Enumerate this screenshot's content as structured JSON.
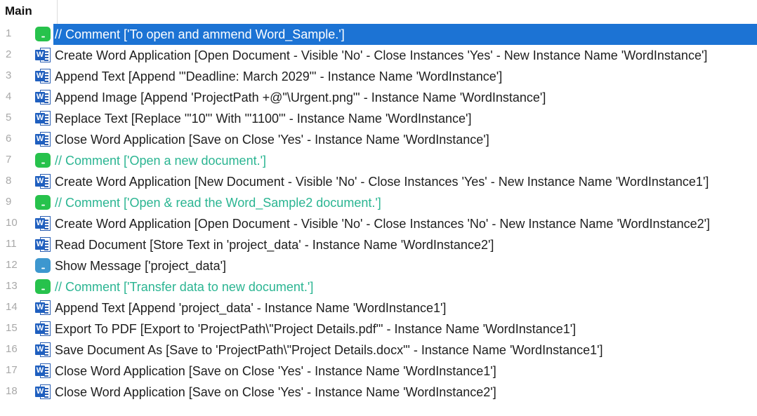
{
  "tab": {
    "label": "Main"
  },
  "lines": [
    {
      "num": "1",
      "kind": "comment",
      "icon": "comment-icon",
      "text": "// Comment ['To open and ammend Word_Sample.']",
      "selected": true
    },
    {
      "num": "2",
      "kind": "word",
      "icon": "word-icon",
      "text": "Create Word Application [Open Document - Visible 'No' - Close Instances 'Yes' - New Instance Name 'WordInstance']"
    },
    {
      "num": "3",
      "kind": "word",
      "icon": "word-icon",
      "text": "Append Text [Append '\"Deadline: March 2029\"' - Instance Name 'WordInstance']"
    },
    {
      "num": "4",
      "kind": "word",
      "icon": "word-icon",
      "text": "Append Image [Append 'ProjectPath +@\"\\Urgent.png\"' - Instance Name 'WordInstance']"
    },
    {
      "num": "5",
      "kind": "word",
      "icon": "word-icon",
      "text": "Replace Text [Replace '\"10\"' With '\"1100\"' - Instance Name 'WordInstance']"
    },
    {
      "num": "6",
      "kind": "word",
      "icon": "word-icon",
      "text": "Close Word Application [Save on Close 'Yes' - Instance Name 'WordInstance']"
    },
    {
      "num": "7",
      "kind": "comment",
      "icon": "comment-icon",
      "text": "// Comment ['Open a new document.']"
    },
    {
      "num": "8",
      "kind": "word",
      "icon": "word-icon",
      "text": "Create Word Application [New Document - Visible 'No' - Close Instances 'Yes' - New Instance Name 'WordInstance1']"
    },
    {
      "num": "9",
      "kind": "comment",
      "icon": "comment-icon",
      "text": "// Comment ['Open & read the Word_Sample2 document.']"
    },
    {
      "num": "10",
      "kind": "word",
      "icon": "word-icon",
      "text": "Create Word Application [Open Document - Visible 'No' - Close Instances 'No' - New Instance Name 'WordInstance2']"
    },
    {
      "num": "11",
      "kind": "word",
      "icon": "word-icon",
      "text": "Read Document [Store Text in 'project_data' - Instance Name 'WordInstance2']"
    },
    {
      "num": "12",
      "kind": "message",
      "icon": "message-icon",
      "text": "Show Message ['project_data']"
    },
    {
      "num": "13",
      "kind": "comment",
      "icon": "comment-icon",
      "text": "// Comment ['Transfer data to new document.']"
    },
    {
      "num": "14",
      "kind": "word",
      "icon": "word-icon",
      "text": "Append Text [Append 'project_data' - Instance Name 'WordInstance1']"
    },
    {
      "num": "15",
      "kind": "word",
      "icon": "word-icon",
      "text": "Export To PDF [Export to 'ProjectPath\\\"Project Details.pdf\"' - Instance Name 'WordInstance1']"
    },
    {
      "num": "16",
      "kind": "word",
      "icon": "word-icon",
      "text": "Save Document As [Save to 'ProjectPath\\\"Project Details.docx\"' - Instance Name 'WordInstance1']"
    },
    {
      "num": "17",
      "kind": "word",
      "icon": "word-icon",
      "text": "Close Word Application [Save on Close 'Yes' - Instance Name 'WordInstance1']"
    },
    {
      "num": "18",
      "kind": "word",
      "icon": "word-icon",
      "text": "Close Word Application [Save on Close 'Yes' - Instance Name 'WordInstance2']"
    }
  ],
  "colors": {
    "selection": "#1c73d4",
    "comment_text": "#2bb592",
    "comment_icon": "#27c24c",
    "message_icon": "#3d97cf",
    "word_icon": "#1f5fbf",
    "line_number": "#a8a8a8"
  }
}
